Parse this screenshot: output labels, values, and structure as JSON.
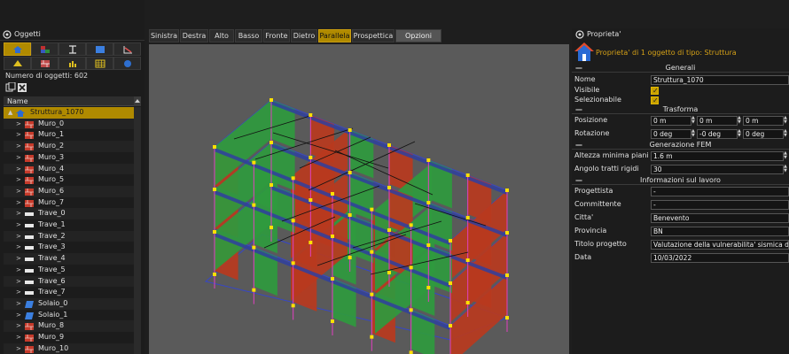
{
  "left": {
    "title": "Oggetti",
    "count_label": "Numero di oggetti: 602",
    "tree_header": "Name",
    "items": [
      {
        "label": "Struttura_1070",
        "kind": "struttura",
        "selected": true,
        "arrow": "▲"
      },
      {
        "label": "Muro_0",
        "kind": "muro",
        "arrow": ">"
      },
      {
        "label": "Muro_1",
        "kind": "muro",
        "arrow": ">"
      },
      {
        "label": "Muro_2",
        "kind": "muro",
        "arrow": ">"
      },
      {
        "label": "Muro_3",
        "kind": "muro",
        "arrow": ">"
      },
      {
        "label": "Muro_4",
        "kind": "muro",
        "arrow": ">"
      },
      {
        "label": "Muro_5",
        "kind": "muro",
        "arrow": ">"
      },
      {
        "label": "Muro_6",
        "kind": "muro",
        "arrow": ">"
      },
      {
        "label": "Muro_7",
        "kind": "muro",
        "arrow": ">"
      },
      {
        "label": "Trave_0",
        "kind": "trave",
        "arrow": ">"
      },
      {
        "label": "Trave_1",
        "kind": "trave",
        "arrow": ">"
      },
      {
        "label": "Trave_2",
        "kind": "trave",
        "arrow": ">"
      },
      {
        "label": "Trave_3",
        "kind": "trave",
        "arrow": ">"
      },
      {
        "label": "Trave_4",
        "kind": "trave",
        "arrow": ">"
      },
      {
        "label": "Trave_5",
        "kind": "trave",
        "arrow": ">"
      },
      {
        "label": "Trave_6",
        "kind": "trave",
        "arrow": ">"
      },
      {
        "label": "Trave_7",
        "kind": "trave",
        "arrow": ">"
      },
      {
        "label": "Solaio_0",
        "kind": "solaio",
        "arrow": ">"
      },
      {
        "label": "Solaio_1",
        "kind": "solaio",
        "arrow": ">"
      },
      {
        "label": "Muro_8",
        "kind": "muro",
        "arrow": ">"
      },
      {
        "label": "Muro_9",
        "kind": "muro",
        "arrow": ">"
      },
      {
        "label": "Muro_10",
        "kind": "muro",
        "arrow": ">"
      }
    ]
  },
  "view_tabs": [
    "Sinistra",
    "Destra",
    "Alto",
    "Basso",
    "Fronte",
    "Dietro",
    "Parallela",
    "Prospettica",
    "Opzioni vista"
  ],
  "active_tab": "Parallela",
  "right": {
    "title": "Proprieta'",
    "subtitle": "Proprieta' di 1 oggetto di tipo: Struttura",
    "sections": {
      "generali": "Generali",
      "trasforma": "Trasforma",
      "fem": "Generazione FEM",
      "lavoro": "Informazioni sul lavoro"
    },
    "nome_label": "Nome",
    "nome": "Struttura_1070",
    "visibile_label": "Visibile",
    "selezionabile_label": "Selezionabile",
    "posizione_label": "Posizione",
    "posizione": [
      "0 m",
      "0 m",
      "0 m"
    ],
    "rotazione_label": "Rotazione",
    "rotazione": [
      "0 deg",
      "-0 deg",
      "0 deg"
    ],
    "altezza_label": "Altezza minima piani",
    "altezza": "1.6 m",
    "angolo_label": "Angolo tratti rigidi",
    "angolo": "30",
    "progettista_label": "Progettista",
    "progettista": "-",
    "committente_label": "Committente",
    "committente": "-",
    "citta_label": "Citta'",
    "citta": "Benevento",
    "provincia_label": "Provincia",
    "provincia": "BN",
    "titolo_label": "Titolo progetto",
    "titolo": "Valutazione della vulnerabilita' sismica di un e",
    "data_label": "Data",
    "data": "10/03/2022"
  },
  "colors": {
    "accent": "#b08a00",
    "wall_red": "#b83a1e",
    "wall_green": "#2f9a3e",
    "wall_blue": "#2f3fa0",
    "node_yellow": "#ffe000"
  }
}
